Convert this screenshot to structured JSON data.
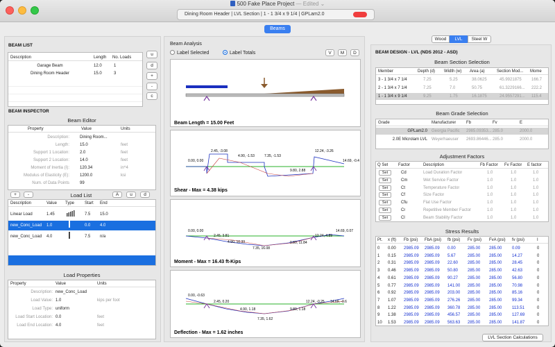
{
  "window": {
    "title": "500 Fake Place Project",
    "edited": " — Edited ⌄",
    "status": "Dining Room Header  |  LVL Section  |  1 - 1 3/4 x 9 1/4  |  GPLam2.0",
    "beams_label": "Beams"
  },
  "beam_list": {
    "heading": "BEAM LIST",
    "columns": [
      "Description",
      "Length",
      "No. Loads"
    ],
    "rows": [
      {
        "description": "Garage Beam",
        "length": "12.0",
        "loads": "1"
      },
      {
        "description": "Dining Room Header",
        "length": "15.0",
        "loads": "3"
      }
    ],
    "buttons": [
      "u",
      "d",
      "+",
      "-",
      "c"
    ]
  },
  "inspector": {
    "heading": "BEAM INSPECTOR",
    "editor_title": "Beam Editor",
    "columns": [
      "Property",
      "Value",
      "Units"
    ],
    "rows": [
      {
        "property": "Description:",
        "value": "Dining Room...",
        "units": ""
      },
      {
        "property": "Length:",
        "value": "15.0",
        "units": "feet"
      },
      {
        "property": "Support 1 Location:",
        "value": "2.0",
        "units": "feet"
      },
      {
        "property": "Support 2 Location:",
        "value": "14.0",
        "units": "feet"
      },
      {
        "property": "Moment of Inertia (I):",
        "value": "120.34",
        "units": "in^4"
      },
      {
        "property": "Modulus of Elasticity (E):",
        "value": "1200.0",
        "units": "ksi"
      },
      {
        "property": "Num. of Data Points",
        "value": "99",
        "units": ""
      }
    ],
    "load_list_title": "Load List",
    "load_buttons_left": [
      "+",
      "-"
    ],
    "load_buttons_right": [
      "A",
      "u",
      "d"
    ],
    "load_columns": [
      "Description",
      "Value",
      "Type",
      "Start",
      "End"
    ],
    "loads": [
      {
        "description": "Linear Load",
        "value": "1.45",
        "type": "bars",
        "start": "7.5",
        "end": "15.0"
      },
      {
        "description": "new_Conc_Load",
        "value": "1.0",
        "type": "single",
        "start": "0.0",
        "end": "4.0"
      },
      {
        "description": "new_Conc_Load",
        "value": "4.0",
        "type": "single",
        "start": "7.5",
        "end": "n/a"
      }
    ],
    "load_props_title": "Load Properties",
    "load_props_columns": [
      "Property",
      "Value",
      "Units"
    ],
    "load_props": [
      {
        "property": "Description:",
        "value": "new_Conc_Load",
        "units": ""
      },
      {
        "property": "Load Value:",
        "value": "1.0",
        "units": "kips per foot"
      },
      {
        "property": "Load Type:",
        "value": "uniform",
        "units": ""
      },
      {
        "property": "Load Start Location:",
        "value": "0.0",
        "units": "feet"
      },
      {
        "property": "Load End Location:",
        "value": "4.0",
        "units": "feet"
      }
    ]
  },
  "analysis": {
    "heading": "Beam Analysis",
    "radio_selected": "Label Selected",
    "radio_totals": "Label Totals",
    "buttons": [
      "V",
      "M",
      "D"
    ],
    "beam_caption": "Beam Length = 15.00 Feet",
    "shear": {
      "caption": "Shear - Max = 4.38 kips",
      "labels": [
        "0.00, 0.00",
        "2.45, -3.08",
        "4.90, -1.53",
        "7.35, -1.53",
        "9.80, 2.88",
        "12.24, -3.26",
        "14.69, -0.4"
      ]
    },
    "moment": {
      "caption": "Moment - Max = 16.43 ft-Kips",
      "labels": [
        "0.00, 0.00",
        "2.45, 3.81",
        "4.90, 10.33",
        "7.35, 16.08",
        "9.80, 11.84",
        "12.24, 4.89",
        "14.69, 0.07"
      ]
    },
    "deflection": {
      "caption": "Deflection - Max = 1.62 inches",
      "labels": [
        "0.00, -0.63",
        "2.45, 0.20",
        "4.90, 1.18",
        "7.35, 1.62",
        "9.80, 1.18",
        "12.24, -0.25",
        "14.69, -0.6"
      ]
    }
  },
  "design": {
    "tabs": [
      "Wood",
      "LVL",
      "Steel W"
    ],
    "heading": "BEAM DESIGN - LVL (NDS 2012 - ASD)",
    "sections_title": "Beam Section Selection",
    "sections_columns": [
      "Member",
      "Depth (d)",
      "Width (w)",
      "Area (a)",
      "Section Mod...",
      "Mome"
    ],
    "sections": [
      {
        "member": "3 - 1 3/4 x 7 1/4",
        "d": "7.25",
        "w": "5.25",
        "a": "38.0625",
        "s": "45.9921875",
        "m": "166.7"
      },
      {
        "member": "2 - 1 3/4 x 7 1/4",
        "d": "7.25",
        "w": "7.0",
        "a": "50.75",
        "s": "61.3229166...",
        "m": "222.2"
      },
      {
        "member": "1 - 1 3/4 x 9 1/4",
        "d": "9.25",
        "w": "1.75",
        "a": "16.1875",
        "s": "24.9557291...",
        "m": "115.4"
      }
    ],
    "grade_title": "Beam Grade Selection",
    "grade_columns": [
      "Grade",
      "Manufacturer",
      "Fb",
      "Fv",
      "E"
    ],
    "grades": [
      {
        "grade": "GPLam2.0",
        "mfr": "Georgia Pacific",
        "fb": "2985.09353...",
        "fv": "285.0",
        "e": "2000.0"
      },
      {
        "grade": "2.0E Microlam LVL",
        "mfr": "Weyerhaeuser",
        "fb": "2693.86446...",
        "fv": "285.0",
        "e": "2000.0"
      }
    ],
    "factors_title": "Adjustment Factors",
    "factors_columns": [
      "Q Set",
      "Factor",
      "Description",
      "Fb Factor",
      "Fv Factor",
      "E factor"
    ],
    "factors": [
      {
        "set": "Set",
        "factor": "Cd",
        "desc": "Load Duration Factor",
        "fb": "1.0",
        "fv": "1.0",
        "e": "1.0"
      },
      {
        "set": "Set",
        "factor": "Cm",
        "desc": "Wet Service Factor",
        "fb": "1.0",
        "fv": "1.0",
        "e": "1.0"
      },
      {
        "set": "Set",
        "factor": "Ct",
        "desc": "Temperature Factor",
        "fb": "1.0",
        "fv": "1.0",
        "e": "1.0"
      },
      {
        "set": "Set",
        "factor": "Cf",
        "desc": "Size Factor",
        "fb": "1.0",
        "fv": "1.0",
        "e": "1.0"
      },
      {
        "set": "Set",
        "factor": "Cfu",
        "desc": "Flat Use Factor",
        "fb": "1.0",
        "fv": "1.0",
        "e": "1.0"
      },
      {
        "set": "Set",
        "factor": "Cr",
        "desc": "Repetitive Member Factor",
        "fb": "1.0",
        "fv": "1.0",
        "e": "1.0"
      },
      {
        "set": "Set",
        "factor": "Cl",
        "desc": "Beam Stability Factor",
        "fb": "1.0",
        "fv": "1.0",
        "e": "1.0"
      }
    ],
    "stress_title": "Stress Results",
    "stress_columns": [
      "Pt.",
      "x (ft)",
      "Fb (psi)",
      "FbA (psi)",
      "fb (psi)",
      "Fv (psi)",
      "FvA (psi)",
      "fv (psi)",
      "I"
    ],
    "stress": [
      [
        "0",
        "0.00",
        "2985.09",
        "2985.09",
        "0.00",
        "285.00",
        "285.00",
        "0.09",
        "0"
      ],
      [
        "1",
        "0.15",
        "2985.09",
        "2985.09",
        "5.67",
        "285.00",
        "285.00",
        "14.27",
        "0"
      ],
      [
        "2",
        "0.31",
        "2985.09",
        "2985.09",
        "22.60",
        "285.00",
        "285.00",
        "28.45",
        "0"
      ],
      [
        "3",
        "0.46",
        "2985.09",
        "2985.09",
        "50.80",
        "285.00",
        "285.00",
        "42.63",
        "0"
      ],
      [
        "4",
        "0.61",
        "2985.09",
        "2985.09",
        "90.27",
        "285.00",
        "285.00",
        "56.80",
        "0"
      ],
      [
        "5",
        "0.77",
        "2985.09",
        "2985.09",
        "141.00",
        "285.00",
        "285.00",
        "70.98",
        "0"
      ],
      [
        "6",
        "0.92",
        "2985.09",
        "2985.09",
        "203.00",
        "285.00",
        "285.00",
        "85.16",
        "0"
      ],
      [
        "7",
        "1.07",
        "2985.09",
        "2985.09",
        "276.26",
        "285.00",
        "285.00",
        "99.34",
        "0"
      ],
      [
        "8",
        "1.22",
        "2985.09",
        "2985.09",
        "360.78",
        "285.00",
        "285.00",
        "113.51",
        "0"
      ],
      [
        "9",
        "1.38",
        "2985.09",
        "2985.09",
        "456.57",
        "285.00",
        "285.00",
        "127.69",
        "0"
      ],
      [
        "10",
        "1.53",
        "2985.09",
        "2985.09",
        "563.63",
        "285.00",
        "285.00",
        "141.87",
        "0"
      ]
    ],
    "calc_button": "LVL Section Calculations"
  }
}
